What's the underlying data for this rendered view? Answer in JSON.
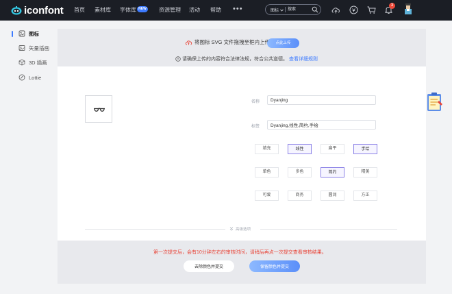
{
  "header": {
    "logo_text": "iconfont",
    "nav": [
      "首页",
      "素材库",
      "字体库",
      "资源管理",
      "活动",
      "帮助"
    ],
    "nav_badge": "NEW",
    "more": "•••",
    "search": {
      "select_label": "图标",
      "placeholder": "搜索"
    },
    "notification_count": "3"
  },
  "sidebar": {
    "items": [
      {
        "label": "图标"
      },
      {
        "label": "矢量插画"
      },
      {
        "label": "3D 插画"
      },
      {
        "label": "Lottie"
      }
    ]
  },
  "upload": {
    "prompt": "将图标 SVG 文件拖拽至框内上传",
    "button": "点此上传",
    "notice": "请确保上传的内容符合法律法规，符合公共道德。",
    "notice_link": "查看详细规则"
  },
  "form": {
    "name_label": "名称",
    "name_value": "Dyanjing",
    "tags_label": "标签",
    "tags_value": "Dyanjing,线性,简约,手绘",
    "style_tags": [
      [
        "填充",
        "线性",
        "扁平",
        "手绘"
      ],
      [
        "单色",
        "多色",
        "简约",
        "精美"
      ],
      [
        "可爱",
        "商务",
        "圆润",
        "方正"
      ]
    ],
    "advanced_label": "高级选项"
  },
  "submit": {
    "warning": "第一次提交后，会有10分钟左右的审核时间，请稍后再点一次提交查看审核结果。",
    "strip_color_button": "去除颜色并提交",
    "keep_color_button": "保留颜色并提交"
  },
  "colors": {
    "accent": "#3d7bff",
    "selected_border": "#8a80e6",
    "warning": "#e8463a",
    "topbar": "#1b1e25"
  }
}
